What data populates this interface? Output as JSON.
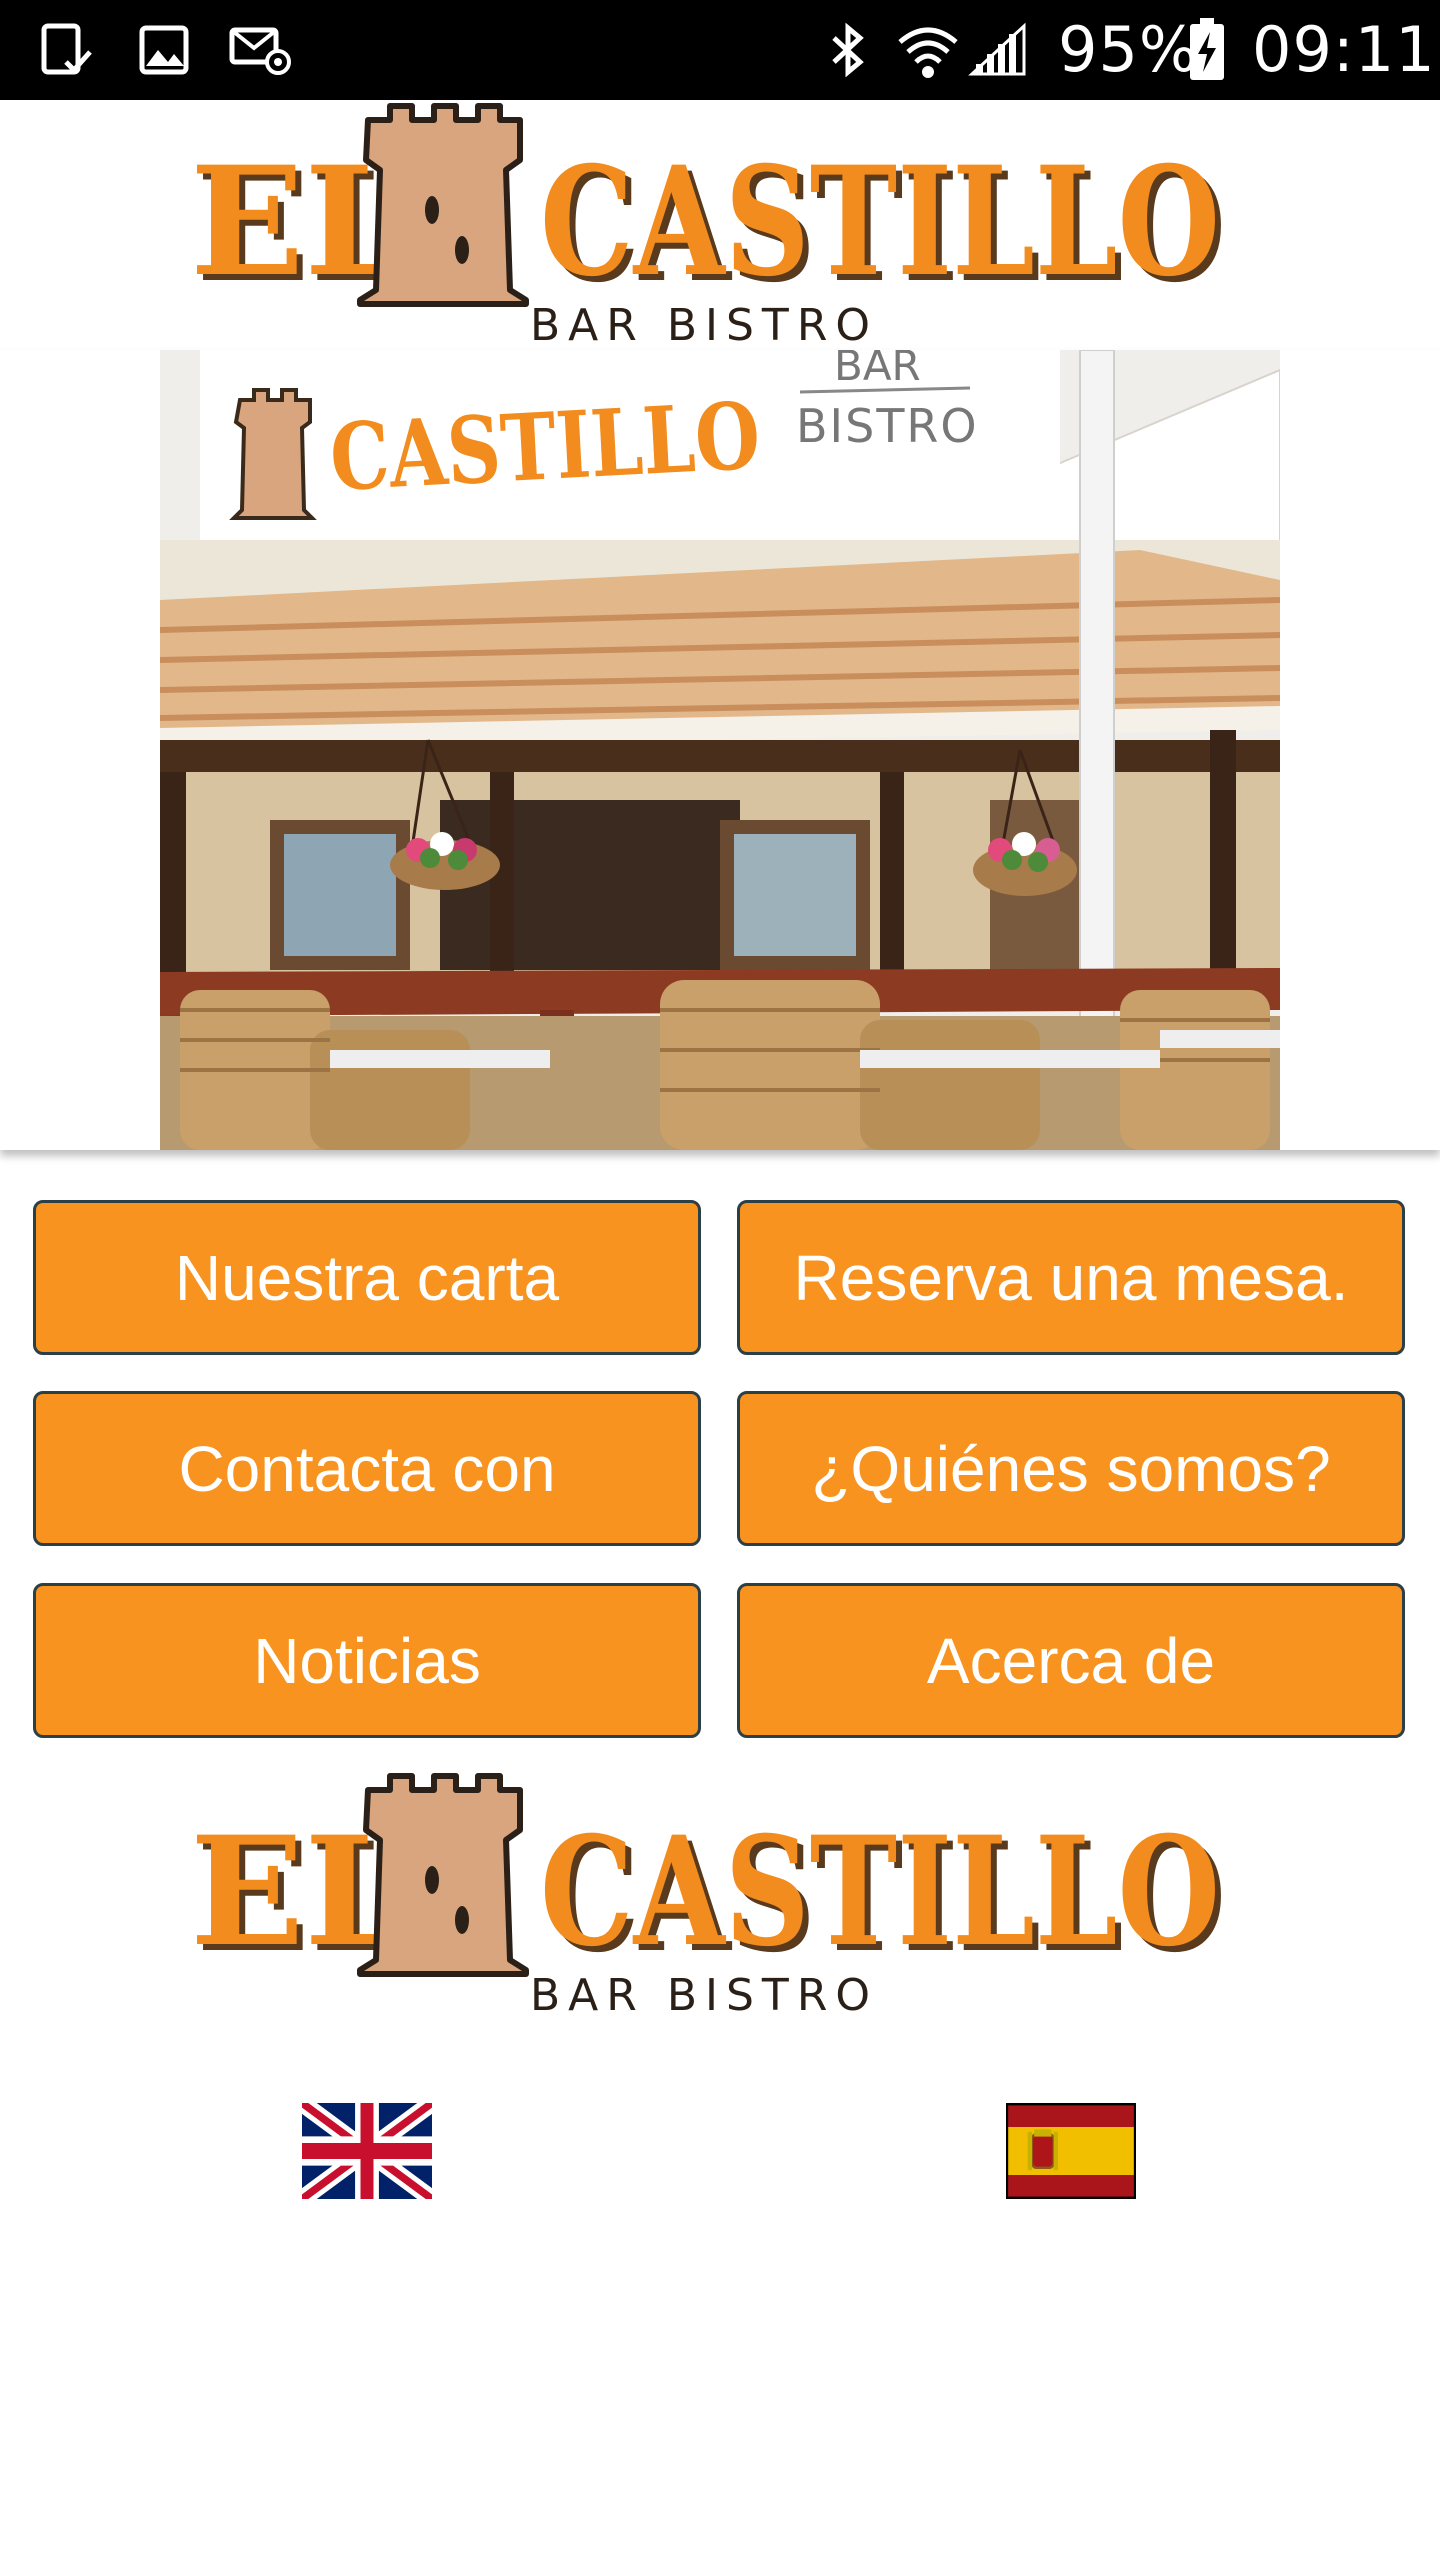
{
  "status_bar": {
    "battery_percent": "95%",
    "time": "09:11",
    "icons": [
      "tablet-check-icon",
      "image-icon",
      "email-at-icon",
      "bluetooth-icon",
      "wifi-icon",
      "signal-icon",
      "battery-charging-icon"
    ]
  },
  "logo": {
    "title_left": "EL",
    "title_right": "CASTILLO",
    "subtitle": "BAR BISTRO"
  },
  "hero_photo": {
    "sign_name": "CASTILLO",
    "sign_bar": "BAR",
    "sign_bistro": "BISTRO"
  },
  "menu": {
    "buttons": [
      {
        "label": "Nuestra carta"
      },
      {
        "label": "Reserva una mesa."
      },
      {
        "label": "Contacta con"
      },
      {
        "label": "¿Quiénes somos?"
      },
      {
        "label": "Noticias"
      },
      {
        "label": "Acerca de"
      }
    ]
  },
  "languages": {
    "flags": [
      "uk-flag-icon",
      "spain-flag-icon"
    ]
  },
  "colors": {
    "brand_orange": "#f7931e",
    "button_border": "#2b3f46",
    "logo_orange": "#f28c1e",
    "tower": "#d9a57e",
    "status_bar": "#000000"
  }
}
